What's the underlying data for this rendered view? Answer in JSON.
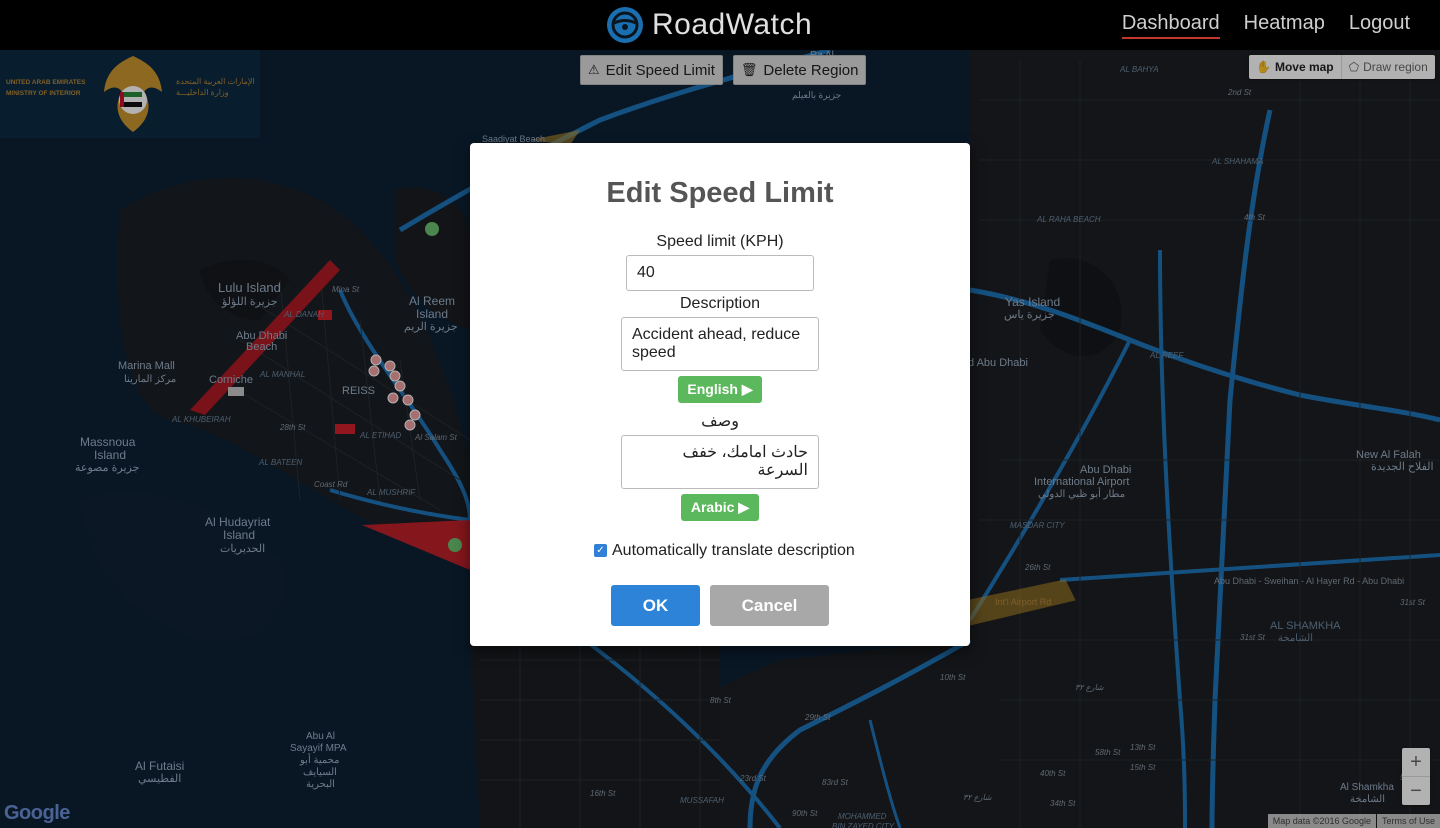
{
  "app": {
    "title": "RoadWatch"
  },
  "nav": {
    "links": [
      {
        "label": "Dashboard",
        "active": true
      },
      {
        "label": "Heatmap",
        "active": false
      },
      {
        "label": "Logout",
        "active": false
      }
    ]
  },
  "toolbar": {
    "edit_speed_limit": "Edit Speed Limit",
    "delete_region": "Delete Region"
  },
  "draw_controls": {
    "move_map": "Move map",
    "draw_region": "Draw region"
  },
  "emblem": {
    "left_text": "UNITED ARAB EMIRATES\nMINISTRY OF INTERIOR",
    "right_text": "الإمارات العربية المتحدة\nوزارة الداخليـــة"
  },
  "map_labels": [
    {
      "t": "Lulu Island",
      "c": "#9db0c6"
    },
    {
      "t": "جزيرة اللؤلؤ",
      "c": "#9db0c6"
    },
    {
      "t": "Abu Dhabi",
      "c": "#9db0c6"
    },
    {
      "t": "Beach",
      "c": "#9db0c6"
    },
    {
      "t": "Marina Mall",
      "c": "#9db0c6"
    },
    {
      "t": "مركز المارينا",
      "c": "#9db0c6"
    },
    {
      "t": "Corniche",
      "c": "#9db0c6"
    },
    {
      "t": "Massnoua",
      "c": "#9db0c6"
    },
    {
      "t": "Island",
      "c": "#9db0c6"
    },
    {
      "t": "جزيرة مصوعة",
      "c": "#9db0c6"
    },
    {
      "t": "Al Hudayriat",
      "c": "#9db0c6"
    },
    {
      "t": "Island",
      "c": "#9db0c6"
    },
    {
      "t": "الحديريات",
      "c": "#9db0c6"
    },
    {
      "t": "Al Reem",
      "c": "#9db0c6"
    },
    {
      "t": "Island",
      "c": "#9db0c6"
    },
    {
      "t": "جزيرة الريم",
      "c": "#9db0c6"
    },
    {
      "t": "REISS",
      "c": "#9db0c6"
    },
    {
      "t": "AL DANAH",
      "c": "#6f88a0"
    },
    {
      "t": "AL MANHAL",
      "c": "#6f88a0"
    },
    {
      "t": "AL KHUBEIRAH",
      "c": "#6f88a0"
    },
    {
      "t": "AL BATEEN",
      "c": "#6f88a0"
    },
    {
      "t": "AL ETIHAD",
      "c": "#6f88a0"
    },
    {
      "t": "AL MUSHRIF",
      "c": "#6f88a0"
    },
    {
      "t": "28th St",
      "c": "#8a97a4"
    },
    {
      "t": "Coast Rd",
      "c": "#8a97a4"
    },
    {
      "t": "Al Salam St",
      "c": "#8a97a4"
    },
    {
      "t": "Mina St",
      "c": "#8a97a4"
    },
    {
      "t": "Saadiyat Beach",
      "c": "#9db0c6"
    },
    {
      "t": "Ra Al",
      "c": "#9db0c6"
    },
    {
      "t": "جزيرة بالعيلم",
      "c": "#9db0c6"
    },
    {
      "t": "AL BAHYA",
      "c": "#6f88a0"
    },
    {
      "t": "AL SHAHAMA",
      "c": "#6f88a0"
    },
    {
      "t": "AL RAHA BEACH",
      "c": "#6f88a0"
    },
    {
      "t": "Yas Island",
      "c": "#9db0c6"
    },
    {
      "t": "جزيرة ياس",
      "c": "#9db0c6"
    },
    {
      "t": "d Abu Dhabi",
      "c": "#9db0c6"
    },
    {
      "t": "AL REEF",
      "c": "#6f88a0"
    },
    {
      "t": "Abu Dhabi",
      "c": "#9db0c6"
    },
    {
      "t": "International Airport",
      "c": "#9db0c6"
    },
    {
      "t": "مطار أبو ظبي الدولي",
      "c": "#9db0c6"
    },
    {
      "t": "MASDAR CITY",
      "c": "#6f88a0"
    },
    {
      "t": "New Al Falah",
      "c": "#9db0c6"
    },
    {
      "t": "الفلاح الجديدة",
      "c": "#9db0c6"
    },
    {
      "t": "AL SHAMKHA",
      "c": "#6f88a0"
    },
    {
      "t": "الشامخة",
      "c": "#6f88a0"
    },
    {
      "t": "Al Shamkha",
      "c": "#9db0c6"
    },
    {
      "t": "الشامخة",
      "c": "#9db0c6"
    },
    {
      "t": "Abu Dhabi - Sweihan - Al Hayer Rd - Abu Dhabi",
      "c": "#8a97a4"
    },
    {
      "t": "Int'l Airport Rd",
      "c": "#b8893a"
    },
    {
      "t": "Abu Al",
      "c": "#9db0c6"
    },
    {
      "t": "Sayayif MPA",
      "c": "#9db0c6"
    },
    {
      "t": "محمية أبو",
      "c": "#9db0c6"
    },
    {
      "t": "السيايف",
      "c": "#9db0c6"
    },
    {
      "t": "البحرية",
      "c": "#9db0c6"
    },
    {
      "t": "Al Futaisi",
      "c": "#9db0c6"
    },
    {
      "t": "الفطيسي",
      "c": "#9db0c6"
    },
    {
      "t": "MUSSAFAH",
      "c": "#6f88a0"
    },
    {
      "t": "MOHAMMED",
      "c": "#6f88a0"
    },
    {
      "t": "BIN ZAYED CITY",
      "c": "#6f88a0"
    },
    {
      "t": "8th St",
      "c": "#8a97a4"
    },
    {
      "t": "16th St",
      "c": "#8a97a4"
    },
    {
      "t": "29th St",
      "c": "#8a97a4"
    },
    {
      "t": "23rd St",
      "c": "#8a97a4"
    },
    {
      "t": "83rd St",
      "c": "#8a97a4"
    },
    {
      "t": "90th St",
      "c": "#8a97a4"
    },
    {
      "t": "10th St",
      "c": "#8a97a4"
    },
    {
      "t": "13th St",
      "c": "#8a97a4"
    },
    {
      "t": "2nd St",
      "c": "#8a97a4"
    },
    {
      "t": "4th St",
      "c": "#8a97a4"
    },
    {
      "t": "31st St",
      "c": "#8a97a4"
    },
    {
      "t": "40th St",
      "c": "#8a97a4"
    },
    {
      "t": "54th St",
      "c": "#8a97a4"
    },
    {
      "t": "34th St",
      "c": "#8a97a4"
    },
    {
      "t": "58th St",
      "c": "#8a97a4"
    },
    {
      "t": "15th St",
      "c": "#8a97a4"
    },
    {
      "t": "31st St",
      "c": "#8a97a4"
    },
    {
      "t": "26th St",
      "c": "#8a97a4"
    },
    {
      "t": "شارع ٣٢",
      "c": "#8a97a4"
    },
    {
      "t": "شارع ٣٢",
      "c": "#8a97a4"
    }
  ],
  "map_controls": {
    "zoom_in": "+",
    "zoom_out": "−",
    "google": "Google",
    "map_data": "Map data ©2016 Google",
    "terms": "Terms of Use"
  },
  "modal": {
    "title": "Edit Speed Limit",
    "speed_label": "Speed limit (KPH)",
    "speed_value": "40",
    "desc_label": "Description",
    "desc_value": "Accident ahead, reduce speed",
    "english_button": "English ▶",
    "arabic_label": "وصف",
    "arabic_value": "حادث امامك، خفف السرعة",
    "arabic_button": "Arabic ▶",
    "auto_translate_label": "Automatically translate description",
    "auto_translate_checked": true,
    "ok": "OK",
    "cancel": "Cancel"
  },
  "colors": {
    "accent": "#2d83d8",
    "green": "#5cb85c",
    "road": "#1f74b8",
    "hazard_zone": "#d0202a",
    "airport_zone": "#c8962a"
  }
}
